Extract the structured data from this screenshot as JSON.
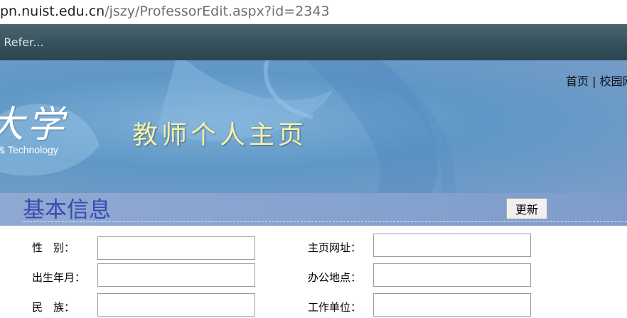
{
  "browser": {
    "url_host": "pn.nuist.edu.cn",
    "url_path": "/jszy/ProfessorEdit.aspx?id=2343",
    "bookmark_label": "t Refer..."
  },
  "banner": {
    "logo_text": "大学",
    "logo_subtitle": "& Technology",
    "title": "教师个人主页",
    "links": {
      "home": "首页",
      "separator": " | ",
      "campus": "校园网"
    }
  },
  "section": {
    "title": "基本信息",
    "update_button": "更新"
  },
  "form": {
    "left": [
      {
        "label": "性　别：",
        "value": ""
      },
      {
        "label": "出生年月：",
        "value": ""
      },
      {
        "label": "民　族：",
        "value": ""
      }
    ],
    "right": [
      {
        "label": "主页网址：",
        "value": ""
      },
      {
        "label": "办公地点：",
        "value": ""
      },
      {
        "label": "工作单位：",
        "value": ""
      }
    ]
  },
  "colors": {
    "section_title": "#3a4ab0",
    "banner_title": "#f5f0a8"
  }
}
